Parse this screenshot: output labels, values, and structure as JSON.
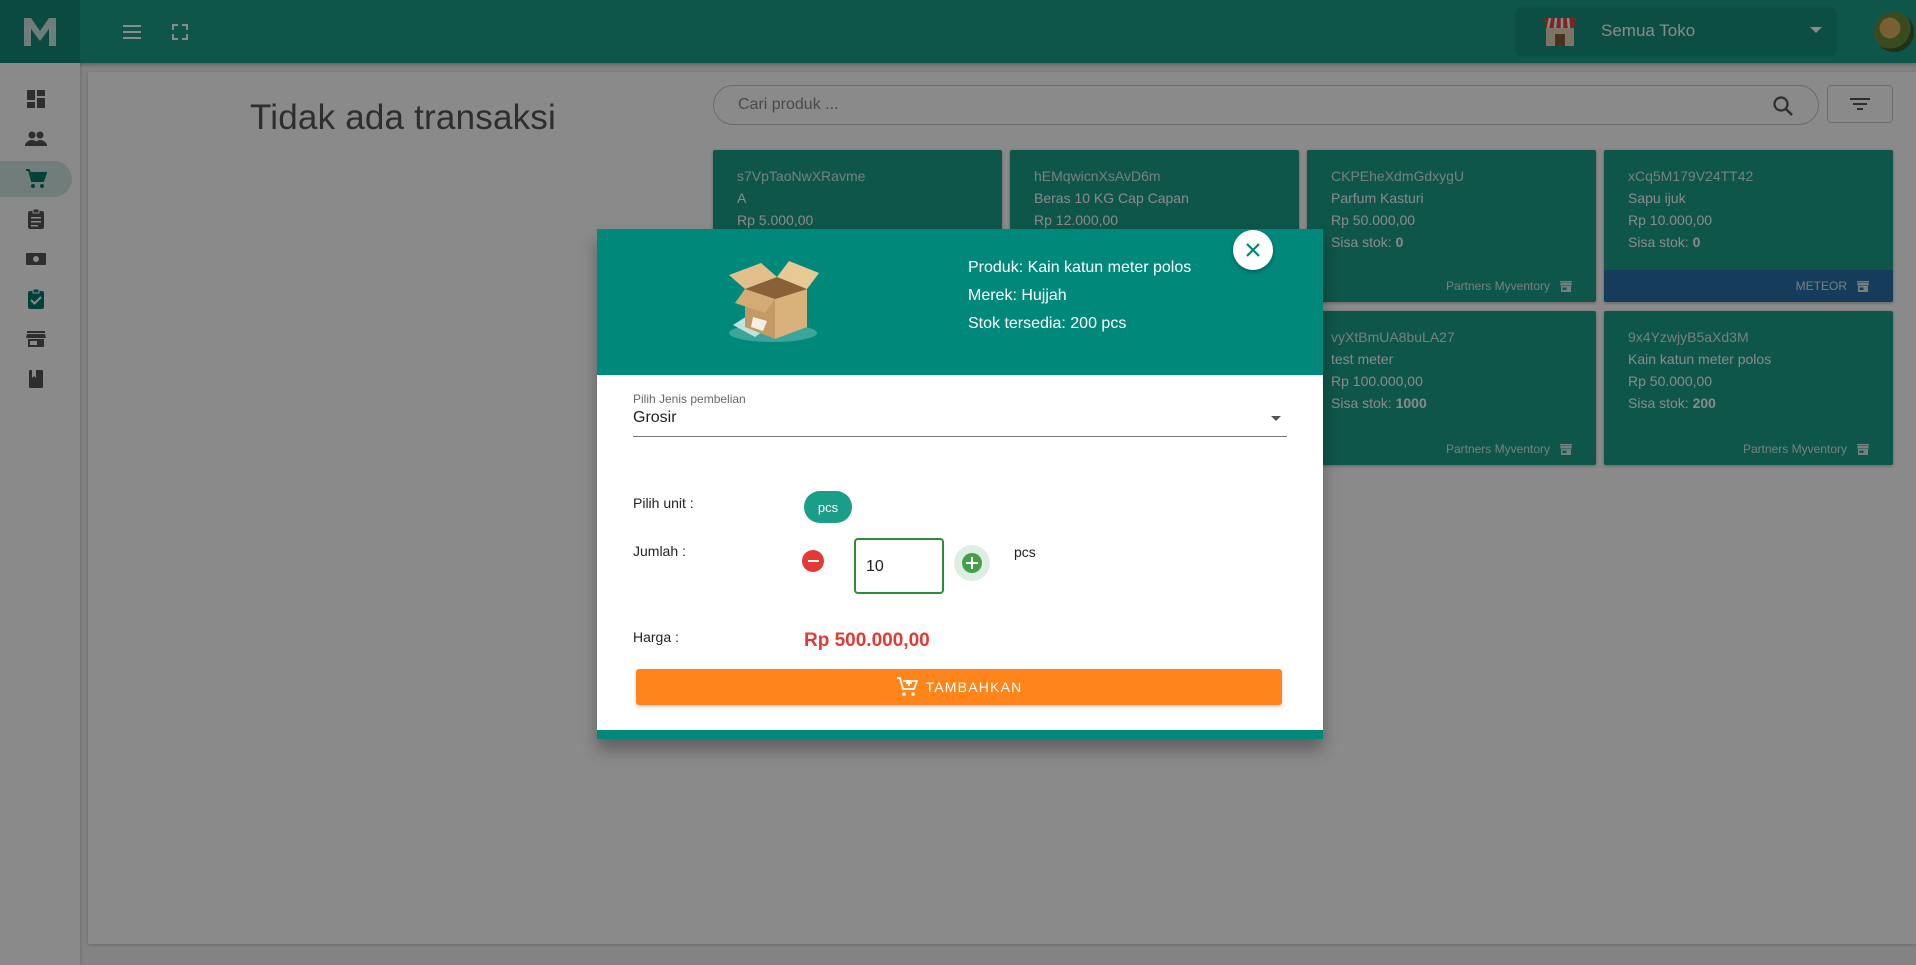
{
  "topbar": {
    "logo_letter": "M",
    "store_name": "Semua Toko"
  },
  "sidebar": {
    "items": [
      {
        "icon": "dashboard-icon"
      },
      {
        "icon": "users-icon"
      },
      {
        "icon": "cart-icon",
        "active": true
      },
      {
        "icon": "clipboard-icon"
      },
      {
        "icon": "money-icon"
      },
      {
        "icon": "clipboard-check-icon"
      },
      {
        "icon": "store-icon"
      },
      {
        "icon": "book-icon"
      }
    ]
  },
  "main": {
    "no_transaction": "Tidak ada transaksi",
    "search_placeholder": "Cari produk ..."
  },
  "products": [
    {
      "code": "s7VpTaoNwXRavme",
      "name": "A",
      "price": "Rp 5.000,00",
      "stock_label": "",
      "stock": "",
      "footer": ""
    },
    {
      "code": "hEMqwicnXsAvD6m",
      "name": "Beras 10 KG Cap Capan",
      "price": "Rp 12.000,00",
      "stock_label": "",
      "stock": "",
      "footer": ""
    },
    {
      "code": "CKPEheXdmGdxygU",
      "name": "Parfum Kasturi",
      "price": "Rp 50.000,00",
      "stock_label": "Sisa stok: ",
      "stock": "0",
      "footer": "Partners Myventory"
    },
    {
      "code": "xCq5M179V24TT42",
      "name": "Sapu ijuk",
      "price": "Rp 10.000,00",
      "stock_label": "Sisa stok: ",
      "stock": "0",
      "footer": "METEOR"
    },
    {
      "code": "vyXtBmUA8buLA27",
      "name": "test meter",
      "price": "Rp 100.000,00",
      "stock_label": "Sisa stok: ",
      "stock": "1000",
      "footer": "Partners Myventory"
    },
    {
      "code": "9x4YzwjyB5aXd3M",
      "name": "Kain katun meter polos",
      "price": "Rp 50.000,00",
      "stock_label": "Sisa stok: ",
      "stock": "200",
      "footer": "Partners Myventory"
    }
  ],
  "dialog": {
    "product_line": "Produk: Kain katun meter polos",
    "brand_line": "Merek: Hujjah",
    "stock_line": "Stok tersedia: 200 pcs",
    "purchase_type_label": "Pilih Jenis pembelian",
    "purchase_type_value": "Grosir",
    "unit_label": "Pilih unit :",
    "unit_value": "pcs",
    "quantity_label": "Jumlah :",
    "quantity_value": "10",
    "quantity_unit": "pcs",
    "price_label": "Harga :",
    "price_value": "Rp 500.000,00",
    "add_button": "TAMBAHKAN"
  },
  "colors": {
    "primary": "#1a9e8a",
    "dialog_header": "#00897b",
    "accent_orange": "#ff851b",
    "price_red": "#e53935",
    "meteor_blue": "#2a6fa8"
  }
}
